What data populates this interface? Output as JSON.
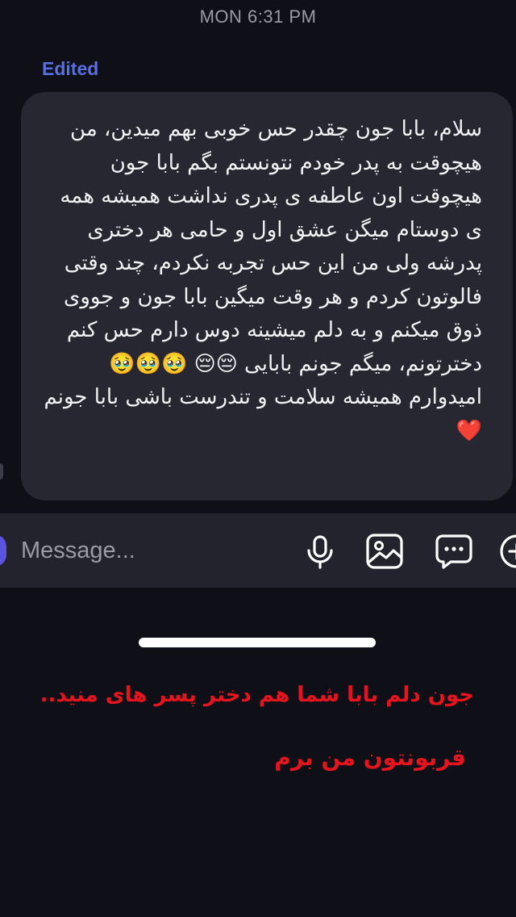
{
  "status": {
    "timestamp": "MON 6:31 PM"
  },
  "message": {
    "edited_label": "Edited",
    "text": "سلام، بابا جون چقدر حس خوبی بهم میدین، من هیچوقت به پدر خودم نتونستم بگم بابا جون هیچوقت اون عاطفه ی پدری نداشت همیشه همه ی دوستام میگن عشق اول و حامی هر دختری پدرشه ولی من این حس تجربه نکردم، چند وقتی فالوتون کردم و هر وقت میگین بابا جون و جووی ذوق میکنم و به دلم میشینه دوس دارم حس کنم دخترتونم، میگم جونم بابایی 😔😔 🥹🥹🥹 امیدوارم همیشه سلامت و تندرست باشی بابا جونم ❤️"
  },
  "composer": {
    "placeholder": "Message...",
    "icons": [
      "microphone-icon",
      "gallery-icon",
      "sticker-chat-icon",
      "add-icon"
    ]
  },
  "overlay": {
    "line1": "جون دلم بابا شما هم دختر پسر های منید..",
    "line2": "قربونتون من برم"
  },
  "colors": {
    "background": "#0e0f17",
    "bubble": "#262731",
    "edited": "#5b6ee1",
    "overlay_text": "#e5141e"
  }
}
